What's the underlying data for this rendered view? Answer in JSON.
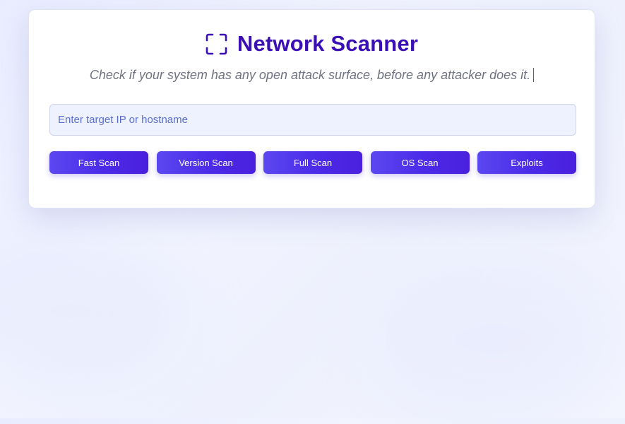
{
  "app": {
    "title": "Network Scanner",
    "subtitle": "Check if your system has any open attack surface, before any attacker does it.",
    "title_icon": "scan-frame-icon"
  },
  "target": {
    "value": "",
    "placeholder": "Enter target IP or hostname"
  },
  "scan_buttons": [
    {
      "label": "Fast Scan"
    },
    {
      "label": "Version Scan"
    },
    {
      "label": "Full Scan"
    },
    {
      "label": "OS Scan"
    },
    {
      "label": "Exploits"
    }
  ],
  "colors": {
    "accent": "#3b0fb6",
    "button_start": "#5b47f0",
    "button_end": "#4a20dd",
    "subtitle": "#6f7280",
    "placeholder": "#5b6fd0"
  }
}
